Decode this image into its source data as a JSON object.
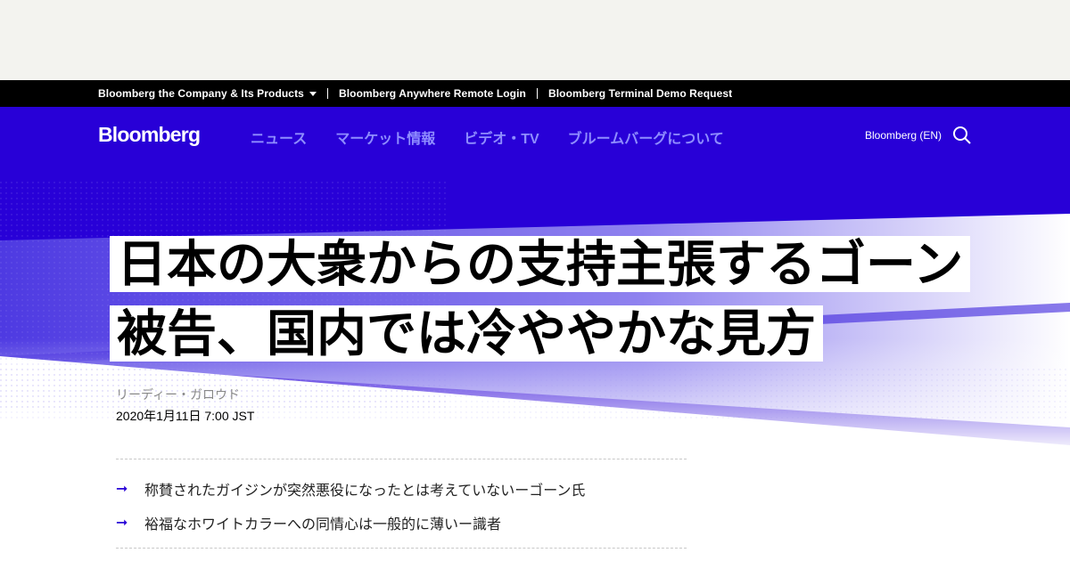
{
  "topbar": {
    "items": [
      "Bloomberg the Company & Its Products",
      "Bloomberg Anywhere Remote Login",
      "Bloomberg Terminal Demo Request"
    ]
  },
  "nav": {
    "logo": "Bloomberg",
    "links": [
      "ニュース",
      "マーケット情報",
      "ビデオ・TV",
      "ブルームバーグについて"
    ],
    "language": "Bloomberg (EN)"
  },
  "article": {
    "headline": "日本の大衆からの支持主張するゴーン被告、国内では冷ややかな見方",
    "byline": "リーディー・ガロウド",
    "date": "2020年1月11日 7:00 JST",
    "bullets": [
      "称賛されたガイジンが突然悪役になったとは考えていないーゴーン氏",
      "裕福なホワイトカラーへの同情心は一般的に薄いー識者"
    ]
  },
  "colors": {
    "brand_blue": "#2800d7",
    "nav_link": "#8f8dff"
  }
}
